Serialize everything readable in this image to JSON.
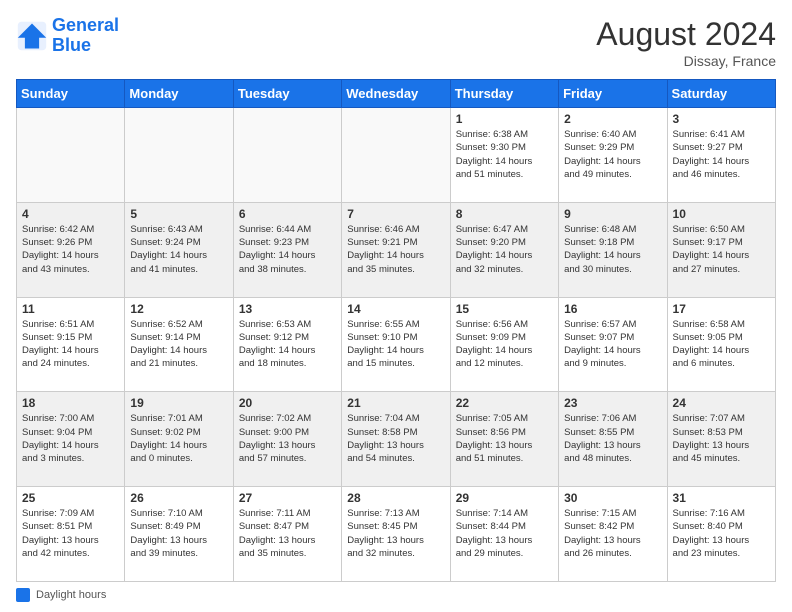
{
  "header": {
    "logo_line1": "General",
    "logo_line2": "Blue",
    "month_title": "August 2024",
    "location": "Dissay, France"
  },
  "footer": {
    "legend_label": "Daylight hours"
  },
  "days_of_week": [
    "Sunday",
    "Monday",
    "Tuesday",
    "Wednesday",
    "Thursday",
    "Friday",
    "Saturday"
  ],
  "weeks": [
    {
      "row_class": "white",
      "days": [
        {
          "num": "",
          "info": ""
        },
        {
          "num": "",
          "info": ""
        },
        {
          "num": "",
          "info": ""
        },
        {
          "num": "",
          "info": ""
        },
        {
          "num": "1",
          "info": "Sunrise: 6:38 AM\nSunset: 9:30 PM\nDaylight: 14 hours\nand 51 minutes."
        },
        {
          "num": "2",
          "info": "Sunrise: 6:40 AM\nSunset: 9:29 PM\nDaylight: 14 hours\nand 49 minutes."
        },
        {
          "num": "3",
          "info": "Sunrise: 6:41 AM\nSunset: 9:27 PM\nDaylight: 14 hours\nand 46 minutes."
        }
      ]
    },
    {
      "row_class": "gray",
      "days": [
        {
          "num": "4",
          "info": "Sunrise: 6:42 AM\nSunset: 9:26 PM\nDaylight: 14 hours\nand 43 minutes."
        },
        {
          "num": "5",
          "info": "Sunrise: 6:43 AM\nSunset: 9:24 PM\nDaylight: 14 hours\nand 41 minutes."
        },
        {
          "num": "6",
          "info": "Sunrise: 6:44 AM\nSunset: 9:23 PM\nDaylight: 14 hours\nand 38 minutes."
        },
        {
          "num": "7",
          "info": "Sunrise: 6:46 AM\nSunset: 9:21 PM\nDaylight: 14 hours\nand 35 minutes."
        },
        {
          "num": "8",
          "info": "Sunrise: 6:47 AM\nSunset: 9:20 PM\nDaylight: 14 hours\nand 32 minutes."
        },
        {
          "num": "9",
          "info": "Sunrise: 6:48 AM\nSunset: 9:18 PM\nDaylight: 14 hours\nand 30 minutes."
        },
        {
          "num": "10",
          "info": "Sunrise: 6:50 AM\nSunset: 9:17 PM\nDaylight: 14 hours\nand 27 minutes."
        }
      ]
    },
    {
      "row_class": "white",
      "days": [
        {
          "num": "11",
          "info": "Sunrise: 6:51 AM\nSunset: 9:15 PM\nDaylight: 14 hours\nand 24 minutes."
        },
        {
          "num": "12",
          "info": "Sunrise: 6:52 AM\nSunset: 9:14 PM\nDaylight: 14 hours\nand 21 minutes."
        },
        {
          "num": "13",
          "info": "Sunrise: 6:53 AM\nSunset: 9:12 PM\nDaylight: 14 hours\nand 18 minutes."
        },
        {
          "num": "14",
          "info": "Sunrise: 6:55 AM\nSunset: 9:10 PM\nDaylight: 14 hours\nand 15 minutes."
        },
        {
          "num": "15",
          "info": "Sunrise: 6:56 AM\nSunset: 9:09 PM\nDaylight: 14 hours\nand 12 minutes."
        },
        {
          "num": "16",
          "info": "Sunrise: 6:57 AM\nSunset: 9:07 PM\nDaylight: 14 hours\nand 9 minutes."
        },
        {
          "num": "17",
          "info": "Sunrise: 6:58 AM\nSunset: 9:05 PM\nDaylight: 14 hours\nand 6 minutes."
        }
      ]
    },
    {
      "row_class": "gray",
      "days": [
        {
          "num": "18",
          "info": "Sunrise: 7:00 AM\nSunset: 9:04 PM\nDaylight: 14 hours\nand 3 minutes."
        },
        {
          "num": "19",
          "info": "Sunrise: 7:01 AM\nSunset: 9:02 PM\nDaylight: 14 hours\nand 0 minutes."
        },
        {
          "num": "20",
          "info": "Sunrise: 7:02 AM\nSunset: 9:00 PM\nDaylight: 13 hours\nand 57 minutes."
        },
        {
          "num": "21",
          "info": "Sunrise: 7:04 AM\nSunset: 8:58 PM\nDaylight: 13 hours\nand 54 minutes."
        },
        {
          "num": "22",
          "info": "Sunrise: 7:05 AM\nSunset: 8:56 PM\nDaylight: 13 hours\nand 51 minutes."
        },
        {
          "num": "23",
          "info": "Sunrise: 7:06 AM\nSunset: 8:55 PM\nDaylight: 13 hours\nand 48 minutes."
        },
        {
          "num": "24",
          "info": "Sunrise: 7:07 AM\nSunset: 8:53 PM\nDaylight: 13 hours\nand 45 minutes."
        }
      ]
    },
    {
      "row_class": "white",
      "days": [
        {
          "num": "25",
          "info": "Sunrise: 7:09 AM\nSunset: 8:51 PM\nDaylight: 13 hours\nand 42 minutes."
        },
        {
          "num": "26",
          "info": "Sunrise: 7:10 AM\nSunset: 8:49 PM\nDaylight: 13 hours\nand 39 minutes."
        },
        {
          "num": "27",
          "info": "Sunrise: 7:11 AM\nSunset: 8:47 PM\nDaylight: 13 hours\nand 35 minutes."
        },
        {
          "num": "28",
          "info": "Sunrise: 7:13 AM\nSunset: 8:45 PM\nDaylight: 13 hours\nand 32 minutes."
        },
        {
          "num": "29",
          "info": "Sunrise: 7:14 AM\nSunset: 8:44 PM\nDaylight: 13 hours\nand 29 minutes."
        },
        {
          "num": "30",
          "info": "Sunrise: 7:15 AM\nSunset: 8:42 PM\nDaylight: 13 hours\nand 26 minutes."
        },
        {
          "num": "31",
          "info": "Sunrise: 7:16 AM\nSunset: 8:40 PM\nDaylight: 13 hours\nand 23 minutes."
        }
      ]
    }
  ]
}
